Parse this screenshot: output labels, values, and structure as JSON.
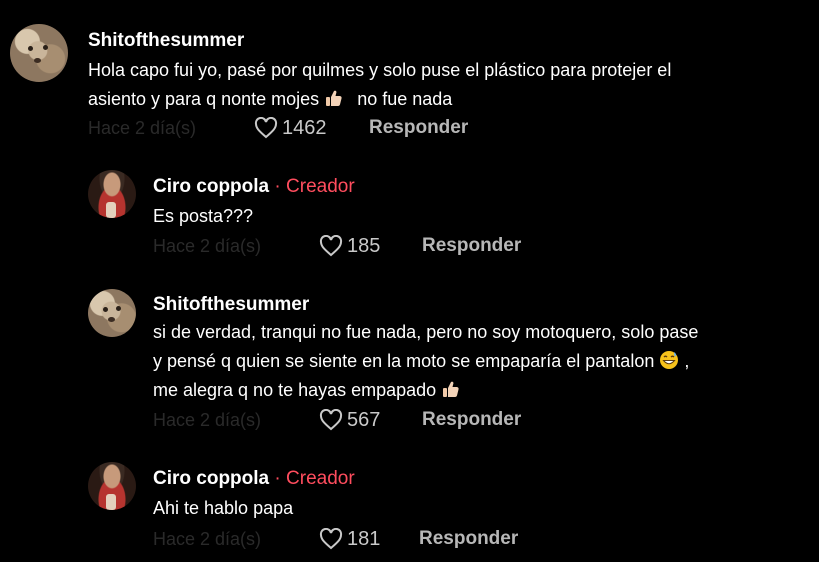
{
  "comments": [
    {
      "username": "Shitofthesummer",
      "text_lines": [
        "Hola capo fui yo, pasé por quilmes y solo puse el plástico para protejer el",
        "asiento y para q nonte mojes",
        "no fue nada"
      ],
      "date": "Hace 2 día(s)",
      "likes": "1462",
      "reply_label": "Responder"
    },
    {
      "username": "Ciro coppola",
      "separator": "·",
      "badge": "Creador",
      "text_lines": [
        "Es posta???"
      ],
      "date": "Hace 2 día(s)",
      "likes": "185",
      "reply_label": "Responder"
    },
    {
      "username": "Shitofthesummer",
      "text_lines": [
        "si de verdad, tranqui no fue nada, pero no soy motoquero, solo pase",
        "y pensé q quien se siente en la moto se empaparía el pantalon",
        ",",
        "me alegra q no te hayas empapado"
      ],
      "date": "Hace 2 día(s)",
      "likes": "567",
      "reply_label": "Responder"
    },
    {
      "username": "Ciro coppola",
      "separator": "·",
      "badge": "Creador",
      "text_lines": [
        "Ahi te hablo papa"
      ],
      "date": "Hace 2 día(s)",
      "likes": "181",
      "reply_label": "Responder"
    }
  ],
  "colors": {
    "background": "#000000",
    "creator_badge": "#ff4d5e",
    "secondary_text": "#b7b7b7",
    "date_text": "#2a2a2a"
  },
  "icons": {
    "like": "heart-outline-icon",
    "thumbs_up": "thumbs-up-emoji-icon",
    "grin_sweat": "grinning-sweat-emoji-icon"
  }
}
